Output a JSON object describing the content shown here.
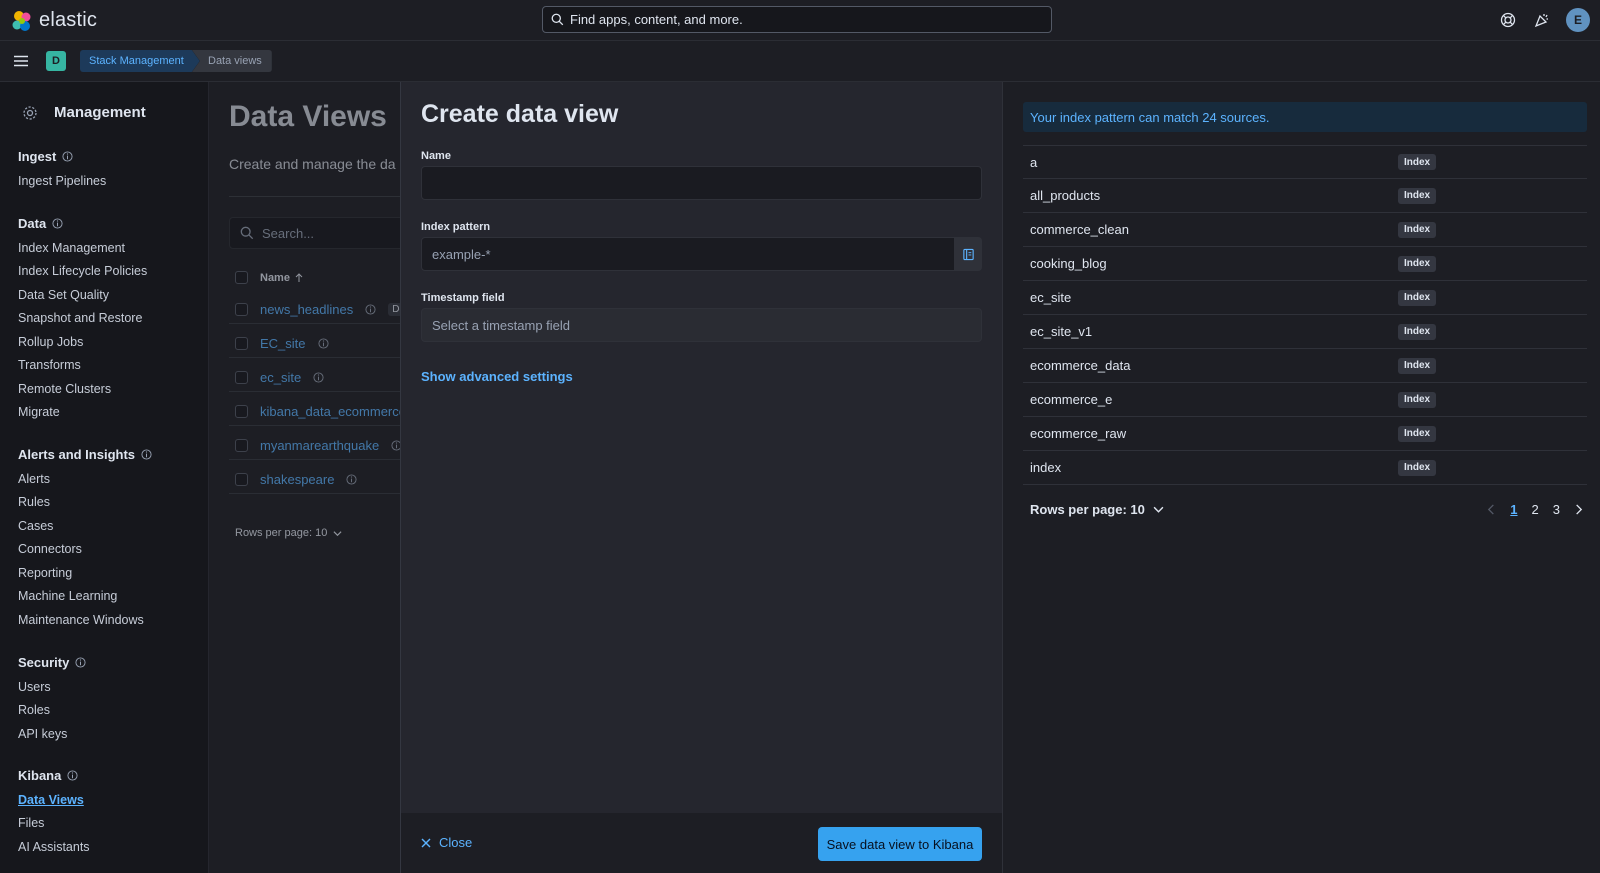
{
  "header": {
    "logo_text": "elastic",
    "search_placeholder": "Find apps, content, and more.",
    "user_initial": "E"
  },
  "subheader": {
    "space_initial": "D",
    "breadcrumbs": [
      "Stack Management",
      "Data views"
    ]
  },
  "sidenav": {
    "title": "Management",
    "groups": {
      "ingest": {
        "label": "Ingest",
        "items": [
          "Ingest Pipelines"
        ]
      },
      "data": {
        "label": "Data",
        "items": [
          "Index Management",
          "Index Lifecycle Policies",
          "Data Set Quality",
          "Snapshot and Restore",
          "Rollup Jobs",
          "Transforms",
          "Remote Clusters",
          "Migrate"
        ]
      },
      "alerts": {
        "label": "Alerts and Insights",
        "items": [
          "Alerts",
          "Rules",
          "Cases",
          "Connectors",
          "Reporting",
          "Machine Learning",
          "Maintenance Windows"
        ]
      },
      "security": {
        "label": "Security",
        "items": [
          "Users",
          "Roles",
          "API keys"
        ]
      },
      "kibana": {
        "label": "Kibana",
        "items": [
          "Data Views",
          "Files",
          "AI Assistants"
        ]
      }
    }
  },
  "bgpage": {
    "title": "Data Views",
    "description": "Create and manage the da",
    "search_placeholder": "Search...",
    "column_name": "Name",
    "rows": [
      "news_headlines",
      "EC_site",
      "ec_site",
      "kibana_data_ecommerce",
      "myanmarearthquake",
      "shakespeare"
    ],
    "default_badge": "De",
    "rows_per_page": "Rows per page: 10"
  },
  "flyout": {
    "title": "Create data view",
    "name_label": "Name",
    "name_value": "",
    "index_pattern_label": "Index pattern",
    "index_pattern_placeholder": "example-*",
    "timestamp_label": "Timestamp field",
    "timestamp_placeholder": "Select a timestamp field",
    "advanced_link": "Show advanced settings",
    "close_label": "Close",
    "save_label": "Save data view to Kibana",
    "callout": "Your index pattern can match 24 sources.",
    "sources": [
      {
        "name": "a",
        "type": "Index"
      },
      {
        "name": "all_products",
        "type": "Index"
      },
      {
        "name": "commerce_clean",
        "type": "Index"
      },
      {
        "name": "cooking_blog",
        "type": "Index"
      },
      {
        "name": "ec_site",
        "type": "Index"
      },
      {
        "name": "ec_site_v1",
        "type": "Index"
      },
      {
        "name": "ecommerce_data",
        "type": "Index"
      },
      {
        "name": "ecommerce_e",
        "type": "Index"
      },
      {
        "name": "ecommerce_raw",
        "type": "Index"
      },
      {
        "name": "index",
        "type": "Index"
      }
    ],
    "rows_per_page": "Rows per page: 10",
    "pages": [
      "1",
      "2",
      "3"
    ],
    "current_page": "1"
  },
  "colors": {
    "accent": "#36a2ef",
    "link": "#5cb3ff",
    "background": "#1d1e24",
    "flyout": "#25262e"
  }
}
